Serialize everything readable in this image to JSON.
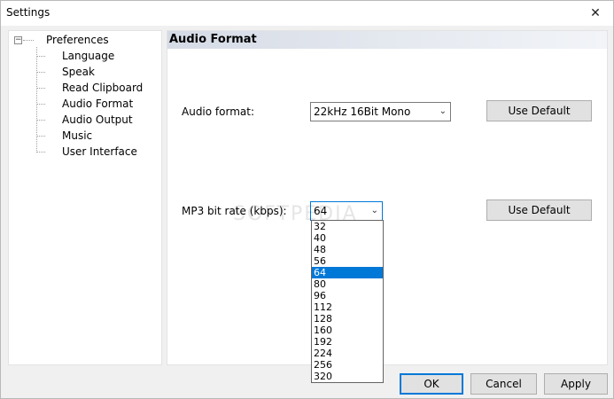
{
  "window": {
    "title": "Settings",
    "close_glyph": "✕"
  },
  "tree": {
    "root": {
      "label": "Preferences",
      "toggle": "−"
    },
    "items": [
      {
        "label": "Language"
      },
      {
        "label": "Speak"
      },
      {
        "label": "Read Clipboard"
      },
      {
        "label": "Audio Format",
        "selected": true
      },
      {
        "label": "Audio Output"
      },
      {
        "label": "Music"
      },
      {
        "label": "User Interface"
      }
    ]
  },
  "content": {
    "header": "Audio Format",
    "audio_format": {
      "label": "Audio format:",
      "value": "22kHz 16Bit Mono",
      "default_button": "Use Default"
    },
    "mp3_bitrate": {
      "label": "MP3 bit rate (kbps):",
      "value": "64",
      "default_button": "Use Default",
      "options": [
        "32",
        "40",
        "48",
        "56",
        "64",
        "80",
        "96",
        "112",
        "128",
        "160",
        "192",
        "224",
        "256",
        "320"
      ],
      "selected_option": "64"
    },
    "watermark": "SOFTPEDIA"
  },
  "footer": {
    "ok": "OK",
    "cancel": "Cancel",
    "apply": "Apply"
  },
  "icons": {
    "caret": "chevron-down-icon",
    "close": "close-icon"
  },
  "colors": {
    "selection": "#0078d7",
    "header_gradient_start": "#d5dbe6"
  }
}
